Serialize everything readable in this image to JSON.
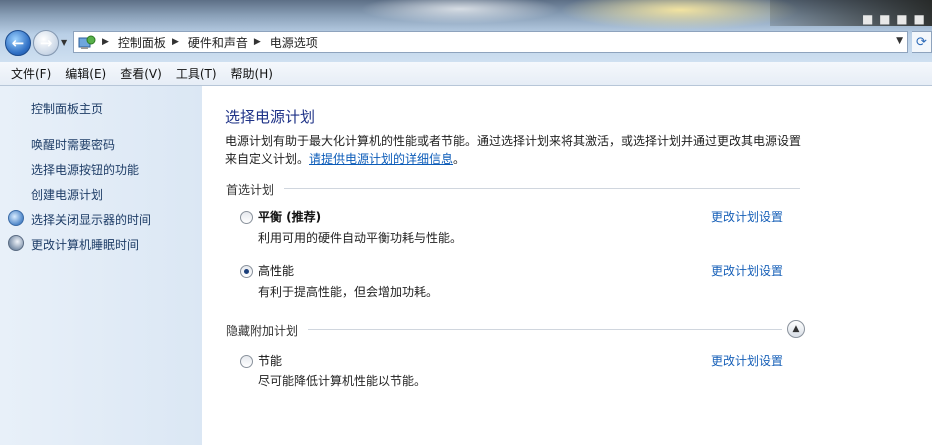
{
  "address": {
    "crumbs": [
      "控制面板",
      "硬件和声音",
      "电源选项"
    ]
  },
  "menu": [
    "文件(F)",
    "编辑(E)",
    "查看(V)",
    "工具(T)",
    "帮助(H)"
  ],
  "sidebar": {
    "home": "控制面板主页",
    "links": [
      "唤醒时需要密码",
      "选择电源按钮的功能",
      "创建电源计划",
      "选择关闭显示器的时间",
      "更改计算机睡眠时间"
    ]
  },
  "main": {
    "title": "选择电源计划",
    "intro_text": "电源计划有助于最大化计算机的性能或者节能。通过选择计划来将其激活，或选择计划并通过更改其电源设置来自定义计划。",
    "intro_link": "请提供电源计划的详细信息",
    "intro_end": "。",
    "preferred_label": "首选计划",
    "hidden_label": "隐藏附加计划",
    "plans": [
      {
        "name": "平衡 (推荐)",
        "desc": "利用可用的硬件自动平衡功耗与性能。",
        "link": "更改计划设置",
        "selected": false
      },
      {
        "name": "高性能",
        "desc": "有利于提高性能，但会增加功耗。",
        "link": "更改计划设置",
        "selected": true
      },
      {
        "name": "节能",
        "desc": "尽可能降低计算机性能以节能。",
        "link": "更改计划设置",
        "selected": false
      }
    ]
  }
}
